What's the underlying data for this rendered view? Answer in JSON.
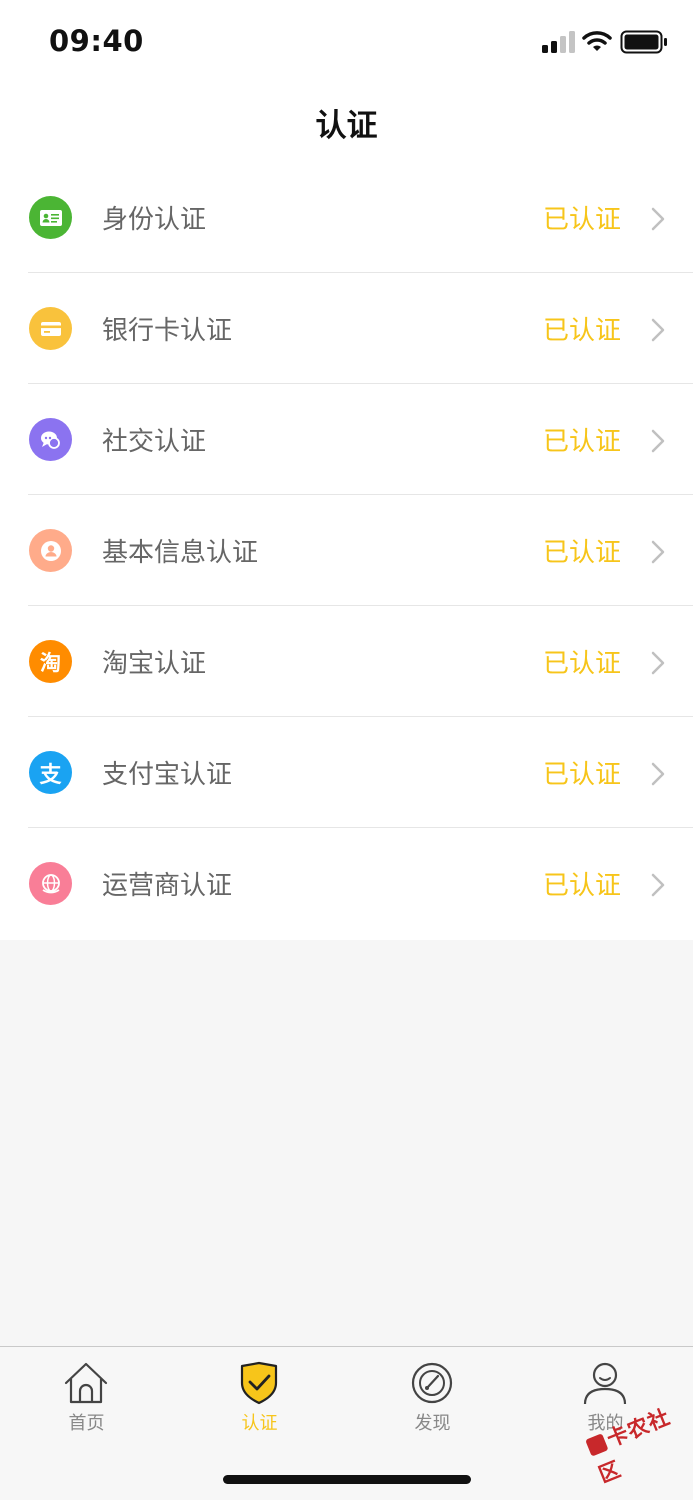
{
  "status_bar": {
    "time": "09:40"
  },
  "header": {
    "title": "认证"
  },
  "items": [
    {
      "label": "身份认证",
      "status": "已认证",
      "icon": "id-card-icon",
      "color": "#4bb534"
    },
    {
      "label": "银行卡认证",
      "status": "已认证",
      "icon": "bank-card-icon",
      "color": "#f9c23c"
    },
    {
      "label": "社交认证",
      "status": "已认证",
      "icon": "social-chat-icon",
      "color": "#8b73f0"
    },
    {
      "label": "基本信息认证",
      "status": "已认证",
      "icon": "user-info-icon",
      "color": "#ffab8a"
    },
    {
      "label": "淘宝认证",
      "status": "已认证",
      "icon": "taobao-icon",
      "icon_text": "淘",
      "color": "#ff8c00"
    },
    {
      "label": "支付宝认证",
      "status": "已认证",
      "icon": "alipay-icon",
      "icon_text": "支",
      "color": "#1aa3f2"
    },
    {
      "label": "运营商认证",
      "status": "已认证",
      "icon": "carrier-globe-icon",
      "color": "#f97e97"
    }
  ],
  "tabs": [
    {
      "label": "首页",
      "icon": "home-icon"
    },
    {
      "label": "认证",
      "icon": "shield-check-icon",
      "active": true
    },
    {
      "label": "发现",
      "icon": "compass-icon"
    },
    {
      "label": "我的",
      "icon": "profile-icon"
    }
  ],
  "colors": {
    "accent": "#f7c51a",
    "text_gray": "#666666",
    "divider": "#e6e6e6"
  },
  "watermark": {
    "text": "卡农社区"
  }
}
